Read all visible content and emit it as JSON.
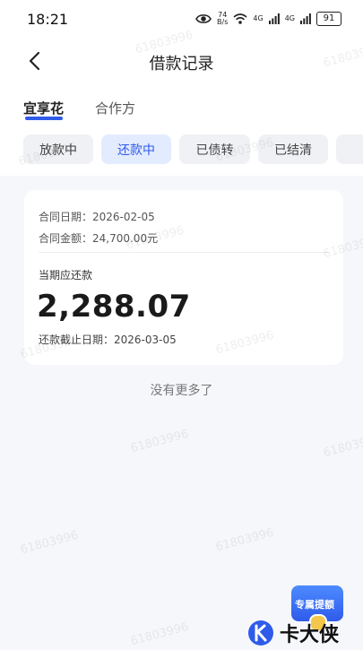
{
  "status_bar": {
    "time": "18:21",
    "net_speed_top": "74",
    "net_speed_bottom": "B/s",
    "signal_1": "4G",
    "signal_2": "4G",
    "battery": "91"
  },
  "nav": {
    "title": "借款记录"
  },
  "tabs": {
    "active": "宜享花",
    "inactive": "合作方"
  },
  "filters": [
    {
      "label": "放款中",
      "active": false
    },
    {
      "label": "还款中",
      "active": true
    },
    {
      "label": "已债转",
      "active": false
    },
    {
      "label": "已结清",
      "active": false
    }
  ],
  "card": {
    "contract_date": "合同日期：2026-02-05",
    "contract_amount": "合同金额：24,700.00元",
    "due_label": "当期应还款",
    "amount": "2,288.07",
    "deadline": "还款截止日期：2026-03-05"
  },
  "footer_text": "没有更多了",
  "watermark": "61803996",
  "fab_label": "专属提额",
  "brand_name": "卡大侠",
  "colors": {
    "accent": "#2f5bea",
    "chip_active_bg": "#e3ebff",
    "page_bg": "#f6f7fb"
  }
}
